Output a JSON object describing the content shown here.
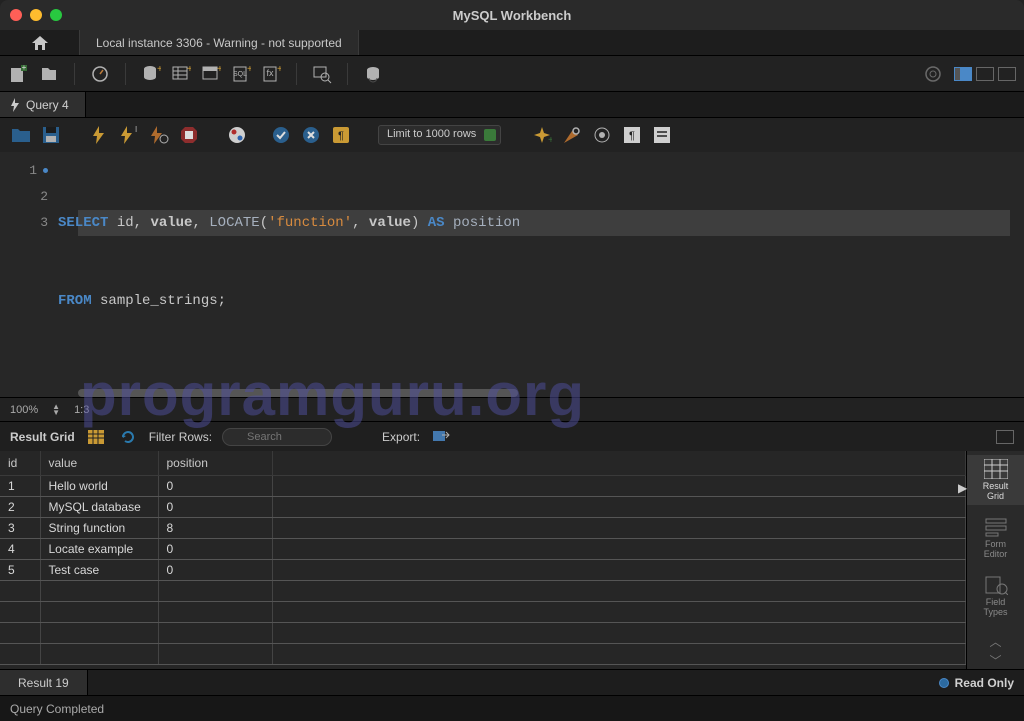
{
  "app": {
    "title": "MySQL Workbench"
  },
  "connection_tab": "Local instance 3306 - Warning - not supported",
  "query_tab": "Query 4",
  "limit_selector": "Limit to 1000 rows",
  "editor": {
    "lines": [
      {
        "n": "1",
        "dot": true
      },
      {
        "n": "2",
        "dot": false
      },
      {
        "n": "3",
        "dot": false
      }
    ],
    "sql_line1": {
      "kw1": "SELECT",
      "c1": " id",
      "p1": ",",
      "c2": " value",
      "p2": ",",
      "fn": " LOCATE",
      "p3": "(",
      "str": "'function'",
      "p4": ",",
      "c3": " value",
      "p5": ")",
      "kw2": " AS",
      "c4": " position"
    },
    "sql_line2": {
      "kw": "FROM",
      "tbl": " sample_strings",
      "p": ";"
    }
  },
  "zoom": {
    "pct": "100%",
    "pos": "1:3"
  },
  "result_toolbar": {
    "label": "Result Grid",
    "filter_label": "Filter Rows:",
    "filter_placeholder": "Search",
    "export_label": "Export:"
  },
  "columns": [
    "id",
    "value",
    "position"
  ],
  "rows": [
    {
      "id": "1",
      "value": "Hello world",
      "position": "0"
    },
    {
      "id": "2",
      "value": "MySQL database",
      "position": "0"
    },
    {
      "id": "3",
      "value": "String function",
      "position": "8"
    },
    {
      "id": "4",
      "value": "Locate example",
      "position": "0"
    },
    {
      "id": "5",
      "value": "Test case",
      "position": "0"
    }
  ],
  "sidebar": {
    "result_grid": "Result\nGrid",
    "form_editor": "Form\nEditor",
    "field_types": "Field\nTypes"
  },
  "result_tab": "Result 19",
  "readonly": "Read Only",
  "status": "Query Completed",
  "watermark": "programguru.org"
}
